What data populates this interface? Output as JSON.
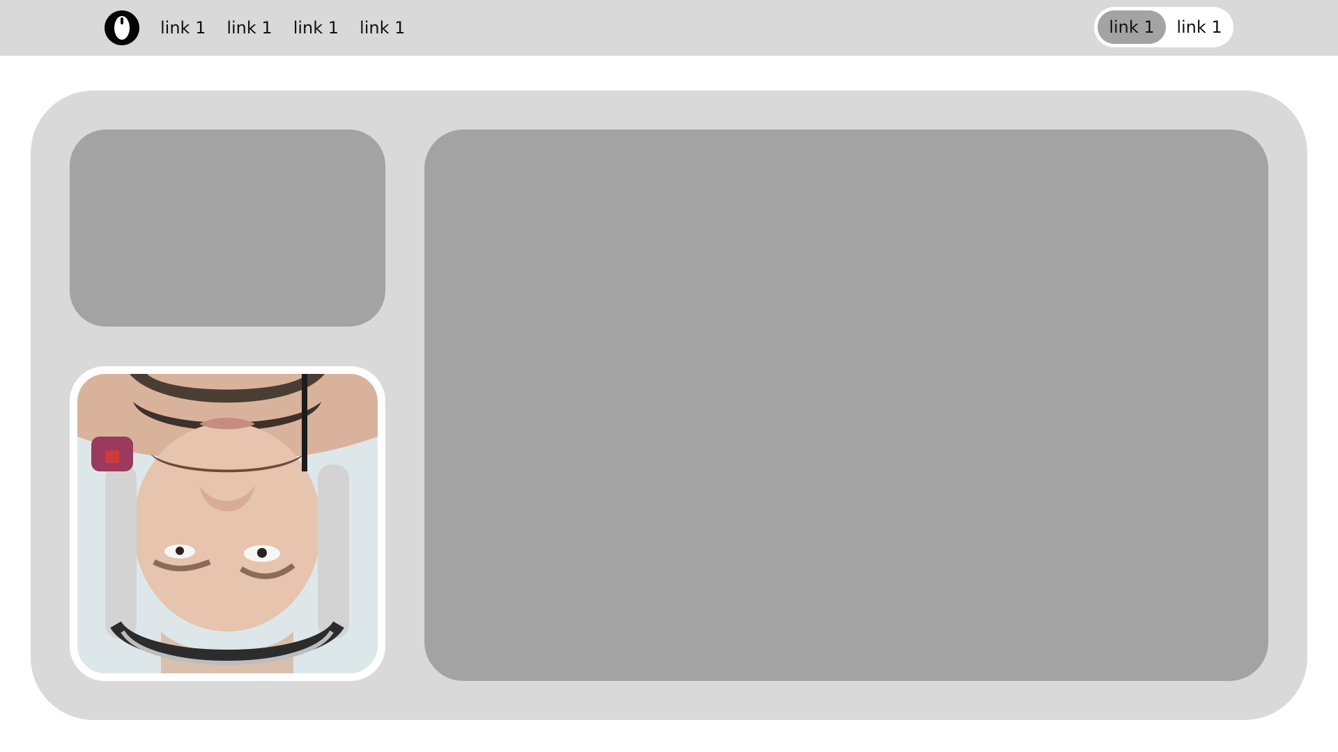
{
  "header": {
    "logo_icon": "o-logo-icon",
    "nav_links": [
      "link 1",
      "link 1",
      "link 1",
      "link 1"
    ],
    "toggle": {
      "active_label": "link 1",
      "inactive_label": "link 1"
    }
  },
  "content": {
    "photo_icon": "portrait-photo",
    "colors": {
      "nav_bg": "#d9d9d9",
      "panel_bg": "#d9d9d9",
      "card_bg": "#a3a3a3",
      "toggle_bg": "#ffffff",
      "toggle_active_bg": "#a3a3a3"
    }
  }
}
